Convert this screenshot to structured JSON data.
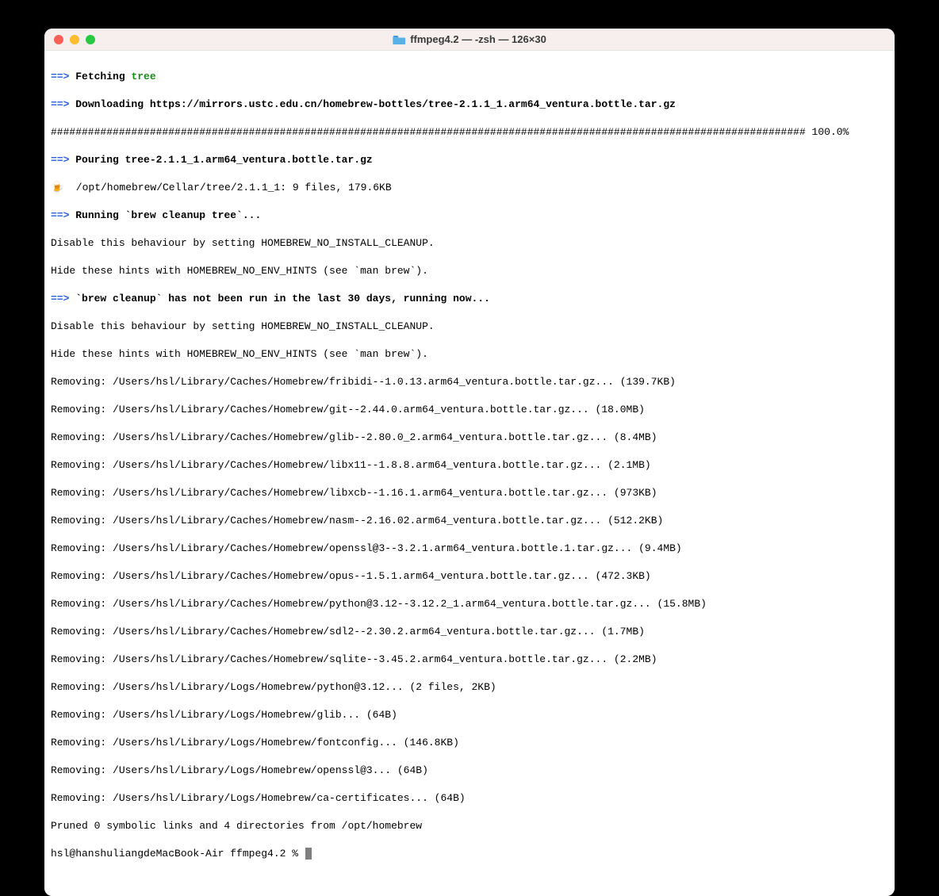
{
  "window": {
    "title": "ffmpeg4.2 — -zsh — 126×30"
  },
  "lines": {
    "fetching_prefix": "==>",
    "fetching_text": "Fetching ",
    "fetching_pkg": "tree",
    "downloading_prefix": "==>",
    "downloading_text": "Downloading https://mirrors.ustc.edu.cn/homebrew-bottles/tree-2.1.1_1.arm64_ventura.bottle.tar.gz",
    "progress": "########################################################################################################################## 100.0%",
    "pouring_prefix": "==>",
    "pouring_text": "Pouring tree-2.1.1_1.arm64_ventura.bottle.tar.gz",
    "beer": "🍺",
    "install_path": "  /opt/homebrew/Cellar/tree/2.1.1_1: 9 files, 179.6KB",
    "running_prefix": "==>",
    "running_text": "Running `brew cleanup tree`...",
    "disable1": "Disable this behaviour by setting HOMEBREW_NO_INSTALL_CLEANUP.",
    "hide1": "Hide these hints with HOMEBREW_NO_ENV_HINTS (see `man brew`).",
    "cleanup_prefix": "==>",
    "cleanup_text": "`brew cleanup` has not been run in the last 30 days, running now...",
    "disable2": "Disable this behaviour by setting HOMEBREW_NO_INSTALL_CLEANUP.",
    "hide2": "Hide these hints with HOMEBREW_NO_ENV_HINTS (see `man brew`).",
    "rm01": "Removing: /Users/hsl/Library/Caches/Homebrew/fribidi--1.0.13.arm64_ventura.bottle.tar.gz... (139.7KB)",
    "rm02": "Removing: /Users/hsl/Library/Caches/Homebrew/git--2.44.0.arm64_ventura.bottle.tar.gz... (18.0MB)",
    "rm03": "Removing: /Users/hsl/Library/Caches/Homebrew/glib--2.80.0_2.arm64_ventura.bottle.tar.gz... (8.4MB)",
    "rm04": "Removing: /Users/hsl/Library/Caches/Homebrew/libx11--1.8.8.arm64_ventura.bottle.tar.gz... (2.1MB)",
    "rm05": "Removing: /Users/hsl/Library/Caches/Homebrew/libxcb--1.16.1.arm64_ventura.bottle.tar.gz... (973KB)",
    "rm06": "Removing: /Users/hsl/Library/Caches/Homebrew/nasm--2.16.02.arm64_ventura.bottle.tar.gz... (512.2KB)",
    "rm07": "Removing: /Users/hsl/Library/Caches/Homebrew/openssl@3--3.2.1.arm64_ventura.bottle.1.tar.gz... (9.4MB)",
    "rm08": "Removing: /Users/hsl/Library/Caches/Homebrew/opus--1.5.1.arm64_ventura.bottle.tar.gz... (472.3KB)",
    "rm09": "Removing: /Users/hsl/Library/Caches/Homebrew/python@3.12--3.12.2_1.arm64_ventura.bottle.tar.gz... (15.8MB)",
    "rm10": "Removing: /Users/hsl/Library/Caches/Homebrew/sdl2--2.30.2.arm64_ventura.bottle.tar.gz... (1.7MB)",
    "rm11": "Removing: /Users/hsl/Library/Caches/Homebrew/sqlite--3.45.2.arm64_ventura.bottle.tar.gz... (2.2MB)",
    "rm12": "Removing: /Users/hsl/Library/Logs/Homebrew/python@3.12... (2 files, 2KB)",
    "rm13": "Removing: /Users/hsl/Library/Logs/Homebrew/glib... (64B)",
    "rm14": "Removing: /Users/hsl/Library/Logs/Homebrew/fontconfig... (146.8KB)",
    "rm15": "Removing: /Users/hsl/Library/Logs/Homebrew/openssl@3... (64B)",
    "rm16": "Removing: /Users/hsl/Library/Logs/Homebrew/ca-certificates... (64B)",
    "pruned": "Pruned 0 symbolic links and 4 directories from /opt/homebrew",
    "prompt": "hsl@hanshuliangdeMacBook-Air ffmpeg4.2 % "
  }
}
